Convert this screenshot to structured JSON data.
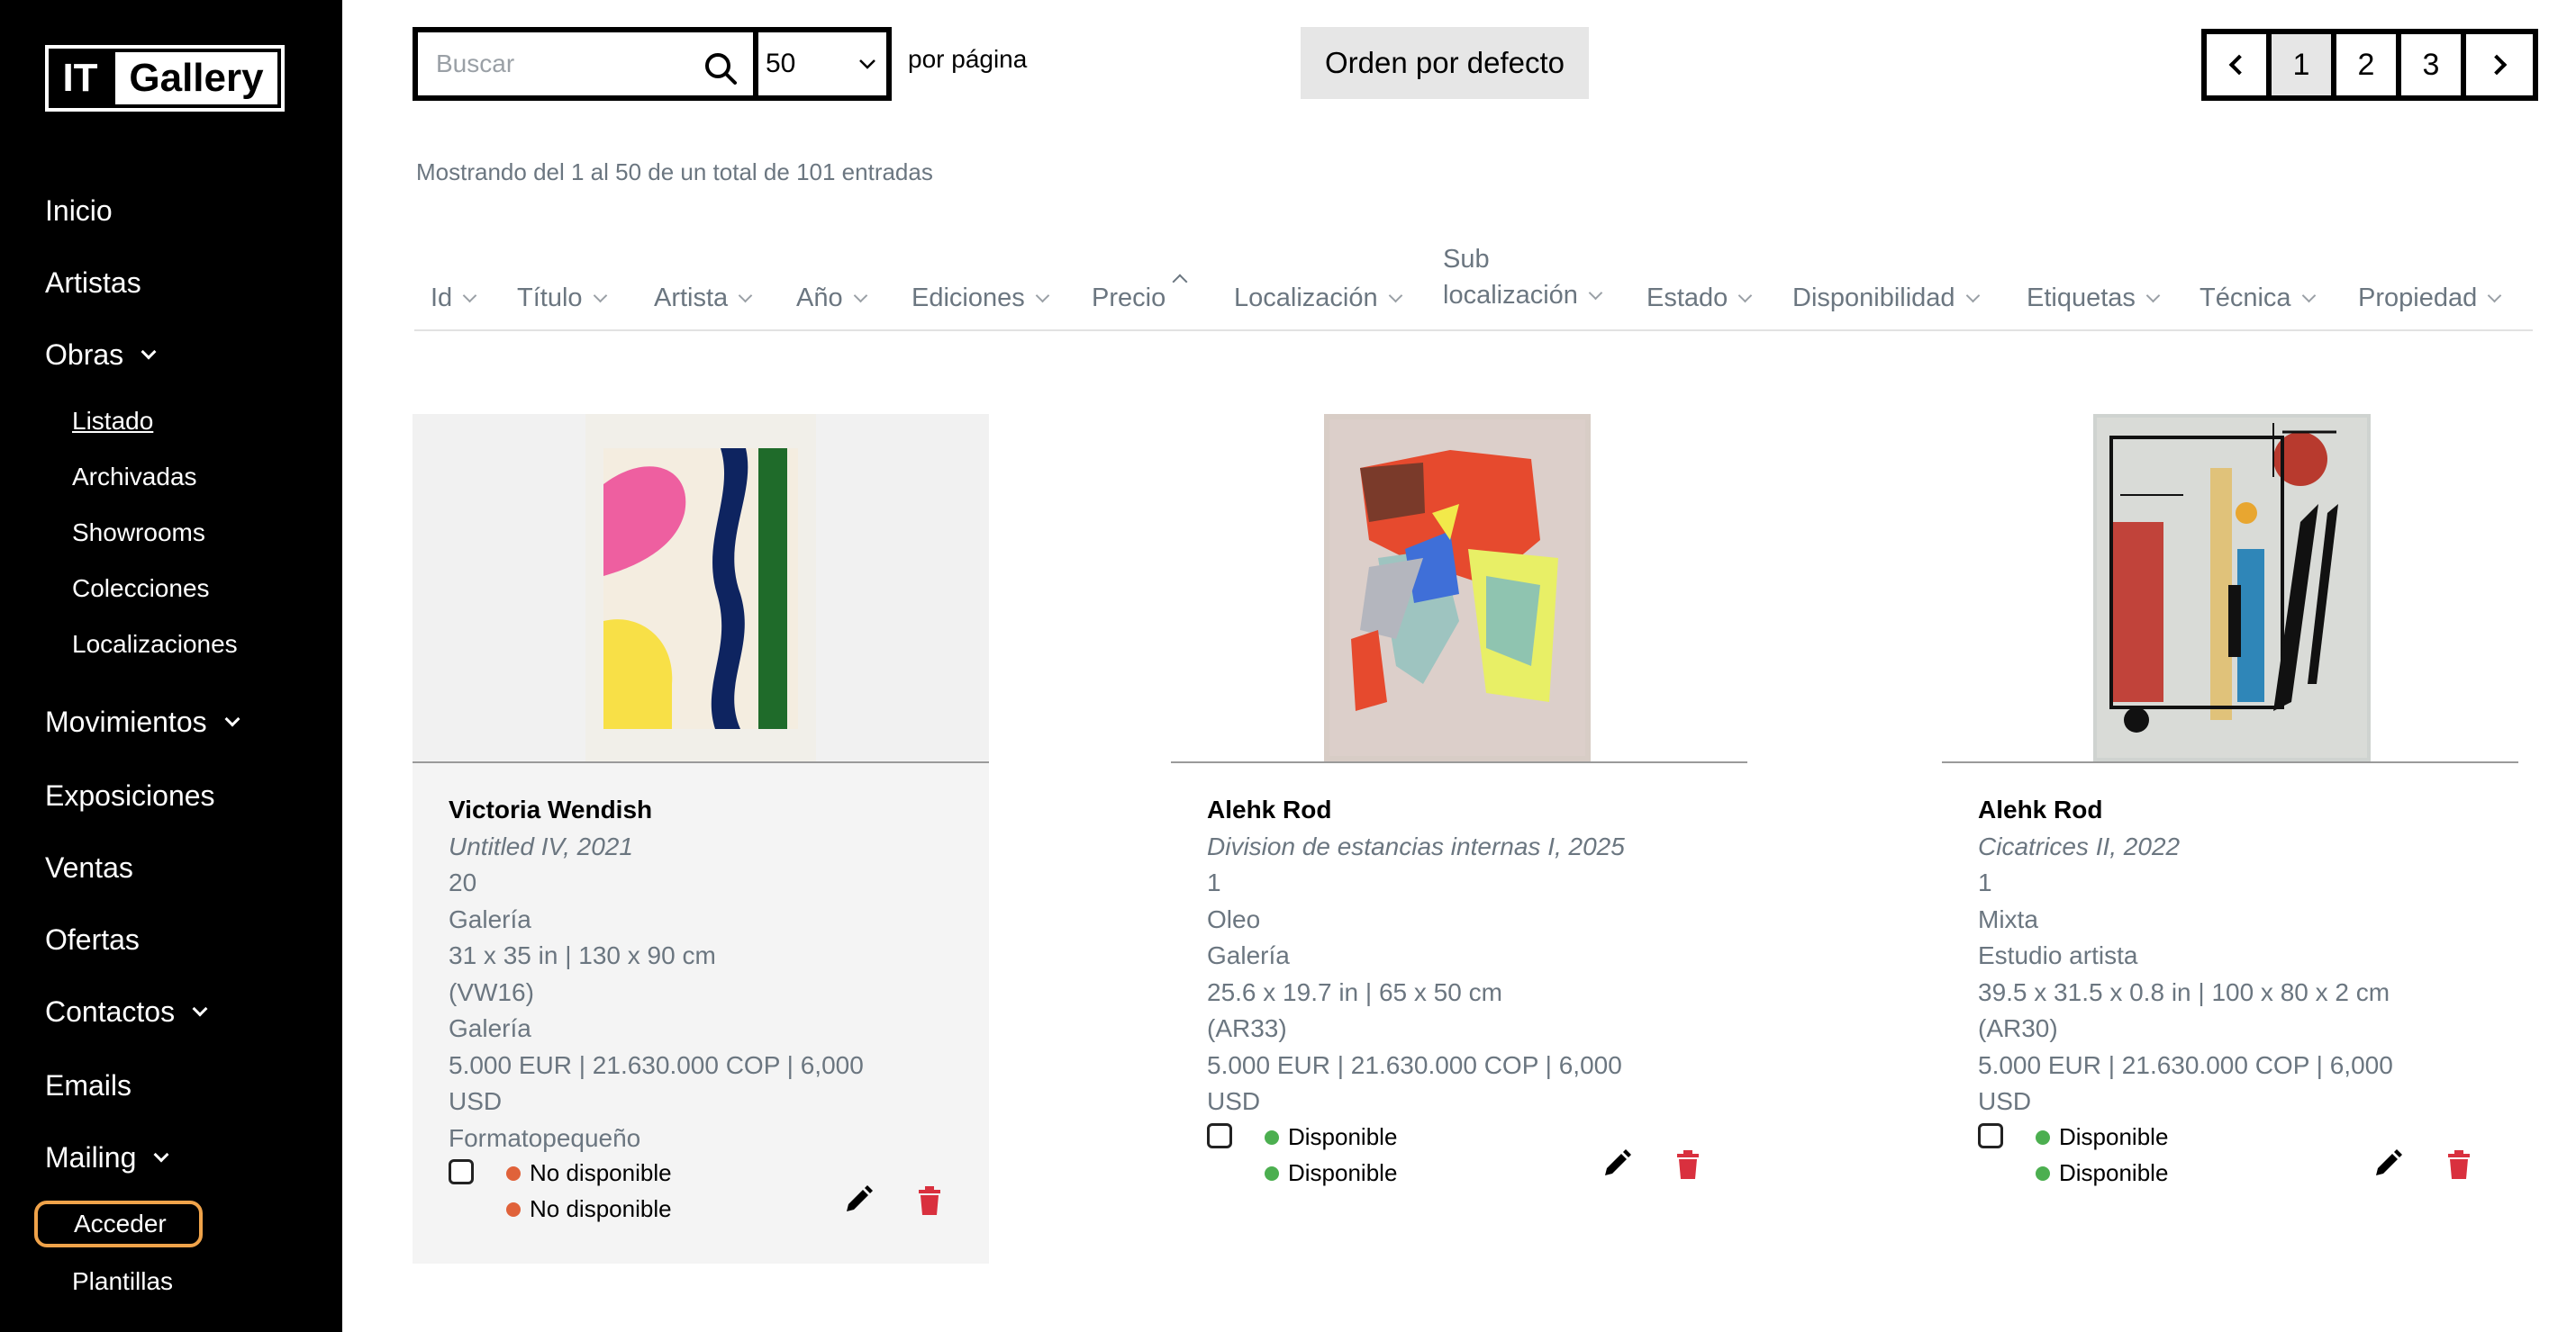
{
  "app": {
    "logo_left": "IT",
    "logo_right": "Gallery"
  },
  "sidebar": {
    "items": [
      {
        "label": "Inicio"
      },
      {
        "label": "Artistas"
      },
      {
        "label": "Obras"
      },
      {
        "label": "Movimientos"
      },
      {
        "label": "Exposiciones"
      },
      {
        "label": "Ventas"
      },
      {
        "label": "Ofertas"
      },
      {
        "label": "Contactos"
      },
      {
        "label": "Emails"
      },
      {
        "label": "Mailing"
      }
    ],
    "obras_sub": [
      {
        "label": "Listado",
        "active": true
      },
      {
        "label": "Archivadas"
      },
      {
        "label": "Showrooms"
      },
      {
        "label": "Colecciones"
      },
      {
        "label": "Localizaciones"
      }
    ],
    "mailing_sub": [
      {
        "label": "Acceder",
        "highlighted": true
      },
      {
        "label": "Plantillas"
      }
    ]
  },
  "toolbar": {
    "search_placeholder": "Buscar",
    "per_page_value": "50",
    "per_page_label": "por página",
    "sort_label": "Orden por defecto"
  },
  "pagination": {
    "pages": [
      "1",
      "2",
      "3"
    ],
    "current": "1"
  },
  "showing_text": "Mostrando del 1 al 50 de un total de 101 entradas",
  "columns": [
    {
      "label": "Id"
    },
    {
      "label": "Título"
    },
    {
      "label": "Artista"
    },
    {
      "label": "Año"
    },
    {
      "label": "Ediciones"
    },
    {
      "label": "Precio",
      "sorted": "asc"
    },
    {
      "label": "Localización"
    },
    {
      "label_line1": "Sub",
      "label_line2": "localización"
    },
    {
      "label": "Estado"
    },
    {
      "label": "Disponibilidad"
    },
    {
      "label": "Etiquetas"
    },
    {
      "label": "Técnica"
    },
    {
      "label": "Propiedad"
    }
  ],
  "cards": [
    {
      "artist": "Victoria Wendish",
      "title": "Untitled IV, 2021",
      "lines": [
        "20",
        "Galería",
        "31 x 35 in | 130 x 90 cm",
        "(VW16)",
        "Galería",
        "5.000 EUR | 21.630.000 COP | 6,000",
        "USD",
        "Formatopequeño"
      ],
      "status1": "No disponible",
      "status2": "No disponible",
      "status_color": "#e0623a"
    },
    {
      "artist": "Alehk Rod",
      "title": "Division de estancias internas I, 2025",
      "lines": [
        "1",
        "Oleo",
        "Galería",
        "25.6 x 19.7 in | 65 x 50 cm",
        "(AR33)",
        "5.000 EUR | 21.630.000 COP | 6,000",
        "USD"
      ],
      "status1": "Disponible",
      "status2": "Disponible",
      "status_color": "#4caf50"
    },
    {
      "artist": "Alehk Rod",
      "title": "Cicatrices II, 2022",
      "lines": [
        "1",
        "Mixta",
        "Estudio artista",
        "39.5 x 31.5 x 0.8 in | 100 x 80 x 2 cm",
        "(AR30)",
        "5.000 EUR | 21.630.000 COP | 6,000",
        "USD"
      ],
      "status1": "Disponible",
      "status2": "Disponible",
      "status_color": "#4caf50"
    }
  ],
  "colors": {
    "sidebar_bg": "#000000",
    "muted_text": "#6b7680",
    "highlight_border": "#f0a34a",
    "delete_red": "#d9303e"
  }
}
